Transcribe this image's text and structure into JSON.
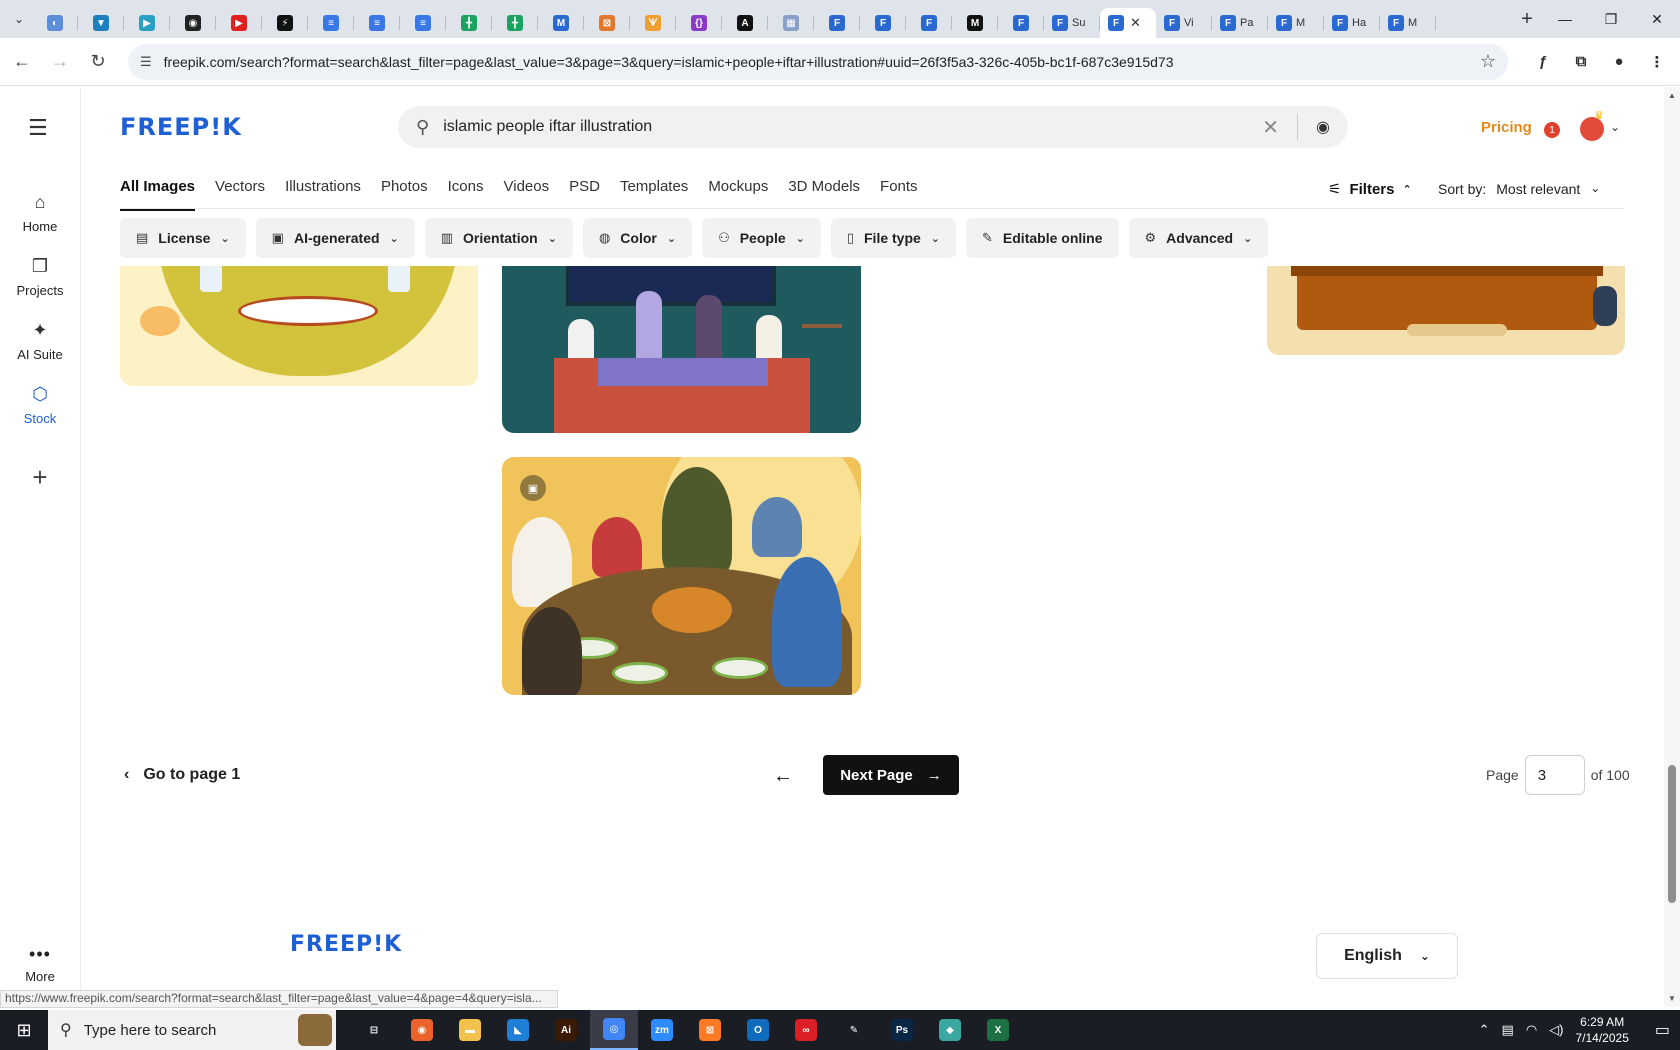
{
  "browser": {
    "tabs": [
      {
        "icon": "tab-icon-1",
        "color": "#5b8dd9",
        "glyph": "◐"
      },
      {
        "icon": "tab-icon-2",
        "color": "#1d7ec0",
        "glyph": "▼"
      },
      {
        "icon": "tab-icon-3",
        "color": "#2aa1c3",
        "glyph": "▶"
      },
      {
        "icon": "tab-icon-4",
        "color": "#222222",
        "glyph": "◉"
      },
      {
        "icon": "tab-icon-5",
        "color": "#e02020",
        "glyph": "▶"
      },
      {
        "icon": "tab-icon-6",
        "color": "#111111",
        "glyph": "⚡"
      },
      {
        "icon": "tab-icon-7",
        "color": "#3b78e7",
        "glyph": "≡"
      },
      {
        "icon": "tab-icon-8",
        "color": "#3b78e7",
        "glyph": "≡"
      },
      {
        "icon": "tab-icon-9",
        "color": "#3b78e7",
        "glyph": "≡"
      },
      {
        "icon": "tab-icon-10",
        "color": "#1aa260",
        "glyph": "╋"
      },
      {
        "icon": "tab-icon-11",
        "color": "#1aa260",
        "glyph": "╋"
      },
      {
        "icon": "tab-icon-12",
        "color": "#2a6ad0",
        "glyph": "M"
      },
      {
        "icon": "tab-icon-13",
        "color": "#e2782c",
        "glyph": "⊠"
      },
      {
        "icon": "tab-icon-14",
        "color": "#f0a030",
        "glyph": "ᗐ"
      },
      {
        "icon": "tab-icon-15",
        "color": "#8a3ac8",
        "glyph": "{}"
      },
      {
        "icon": "tab-icon-16",
        "color": "#111111",
        "glyph": "A"
      },
      {
        "icon": "tab-icon-17",
        "color": "#8aa0c8",
        "glyph": "▦"
      },
      {
        "icon": "tab-icon-18",
        "color": "#2a6ad0",
        "glyph": "F"
      },
      {
        "icon": "tab-icon-19",
        "color": "#2a6ad0",
        "glyph": "F"
      },
      {
        "icon": "tab-icon-20",
        "color": "#2a6ad0",
        "glyph": "F"
      },
      {
        "icon": "tab-icon-21",
        "color": "#111111",
        "glyph": "M"
      },
      {
        "icon": "tab-icon-22",
        "color": "#2a6ad0",
        "glyph": "F"
      }
    ],
    "titled_tabs": [
      {
        "label": "Su",
        "active": false
      },
      {
        "label": "",
        "active": true
      },
      {
        "label": "Vi",
        "active": false
      },
      {
        "label": "Pa",
        "active": false
      },
      {
        "label": "M",
        "active": false
      },
      {
        "label": "Ha",
        "active": false
      },
      {
        "label": "M",
        "active": false
      }
    ],
    "url": "freepik.com/search?format=search&last_filter=page&last_value=3&page=3&query=islamic+people+iftar+illustration#uuid=26f3f5a3-326c-405b-bc1f-687c3e915d73",
    "status_url": "https://www.freepik.com/search?format=search&last_filter=page&last_value=4&page=4&query=isla..."
  },
  "sidebar": {
    "items": [
      {
        "label": "Home",
        "icon": "home-icon"
      },
      {
        "label": "Projects",
        "icon": "projects-icon"
      },
      {
        "label": "AI Suite",
        "icon": "sparkle-icon"
      },
      {
        "label": "Stock",
        "icon": "stock-icon"
      }
    ],
    "more_label": "More"
  },
  "header": {
    "logo": "FREEP!K",
    "search_value": "islamic people iftar illustration",
    "pricing_label": "Pricing",
    "notification_count": "1"
  },
  "categories": {
    "tabs": [
      "All Images",
      "Vectors",
      "Illustrations",
      "Photos",
      "Icons",
      "Videos",
      "PSD",
      "Templates",
      "Mockups",
      "3D Models",
      "Fonts"
    ],
    "active": "All Images",
    "filters_label": "Filters",
    "sort_prefix": "Sort by:",
    "sort_value": "Most relevant"
  },
  "chips": [
    {
      "label": "License",
      "dropdown": true
    },
    {
      "label": "AI-generated",
      "dropdown": true
    },
    {
      "label": "Orientation",
      "dropdown": true
    },
    {
      "label": "Color",
      "dropdown": true
    },
    {
      "label": "People",
      "dropdown": true
    },
    {
      "label": "File type",
      "dropdown": true
    },
    {
      "label": "Editable online",
      "dropdown": false
    },
    {
      "label": "Advanced",
      "dropdown": true
    }
  ],
  "pagination": {
    "goto_label": "Go to page 1",
    "next_label": "Next Page",
    "page_label": "Page",
    "page_value": "3",
    "of_label": "of 100"
  },
  "footer": {
    "logo": "FREEP!K",
    "language": "English"
  },
  "taskbar": {
    "search_placeholder": "Type here to search",
    "time": "6:29 AM",
    "date": "7/14/2025",
    "apps": [
      {
        "name": "task-view",
        "color": "#1b1d24",
        "glyph": "⊟"
      },
      {
        "name": "firefox",
        "color": "#e8642a",
        "glyph": "◉"
      },
      {
        "name": "file-explorer",
        "color": "#f2c14e",
        "glyph": "▬"
      },
      {
        "name": "vscode",
        "color": "#1f7ed6",
        "glyph": "◣"
      },
      {
        "name": "illustrator",
        "color": "#3a1a05",
        "glyph": "Ai"
      },
      {
        "name": "chrome",
        "color": "#4285f4",
        "glyph": "◎"
      },
      {
        "name": "zoom",
        "color": "#2d8cff",
        "glyph": "zm"
      },
      {
        "name": "xampp",
        "color": "#fb7a24",
        "glyph": "⊠"
      },
      {
        "name": "outlook",
        "color": "#0f6cbd",
        "glyph": "O"
      },
      {
        "name": "creative-cloud",
        "color": "#da1f26",
        "glyph": "∞"
      },
      {
        "name": "inkscape",
        "color": "#1b1d24",
        "glyph": "✎"
      },
      {
        "name": "photoshop",
        "color": "#0a2647",
        "glyph": "Ps"
      },
      {
        "name": "app-gem",
        "color": "#3aa7a0",
        "glyph": "◆"
      },
      {
        "name": "excel",
        "color": "#1d7044",
        "glyph": "X"
      }
    ]
  }
}
